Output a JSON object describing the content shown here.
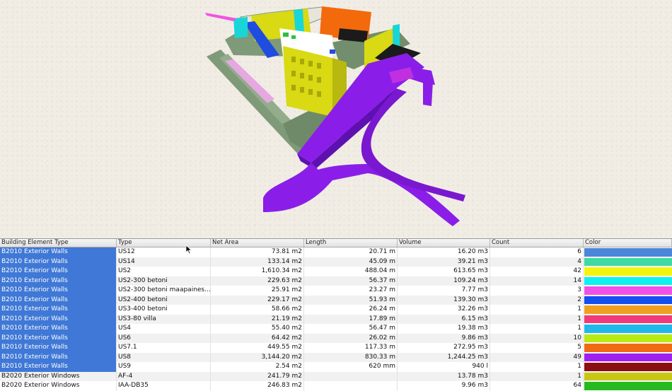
{
  "scene": {
    "colors": {
      "purple": "#8a1ee8",
      "yellow": "#d9d914",
      "sage": "#7f9a78",
      "orange": "#f26a0c",
      "cyan": "#18d6d8",
      "blue": "#1f4de0",
      "magenta": "#f055e0",
      "darkred": "#6a0f16",
      "black": "#1b1b1b",
      "green": "#2fbf3c"
    }
  },
  "table": {
    "columns": [
      "Building Element Type",
      "Type",
      "Net Area",
      "Length",
      "Volume",
      "Count",
      "Color"
    ],
    "rows": [
      {
        "bet": "B2010 Exterior Walls",
        "type": "US12",
        "area": "73.81 m2",
        "length": "20.71 m",
        "volume": "16.20 m3",
        "count": "6",
        "color": "#4a86d9",
        "selected": true
      },
      {
        "bet": "B2010 Exterior Walls",
        "type": "US14",
        "area": "133.14 m2",
        "length": "45.09 m",
        "volume": "39.21 m3",
        "count": "4",
        "color": "#3fd9a6",
        "selected": true
      },
      {
        "bet": "B2010 Exterior Walls",
        "type": "US2",
        "area": "1,610.34 m2",
        "length": "488.04 m",
        "volume": "613.65 m3",
        "count": "42",
        "color": "#f4f40e",
        "selected": true
      },
      {
        "bet": "B2010 Exterior Walls",
        "type": "US2-300 betoni",
        "area": "229.63 m2",
        "length": "56.37 m",
        "volume": "109.24 m3",
        "count": "14",
        "color": "#10f0f0",
        "selected": true
      },
      {
        "bet": "B2010 Exterior Walls",
        "type": "US2-300 betoni maapaines...",
        "area": "25.91 m2",
        "length": "23.27 m",
        "volume": "7.77 m3",
        "count": "3",
        "color": "#f050e8",
        "selected": true
      },
      {
        "bet": "B2010 Exterior Walls",
        "type": "US2-400 betoni",
        "area": "229.17 m2",
        "length": "51.93 m",
        "volume": "139.30 m3",
        "count": "2",
        "color": "#1450f0",
        "selected": true
      },
      {
        "bet": "B2010 Exterior Walls",
        "type": "US3-400 betoni",
        "area": "58.66 m2",
        "length": "26.24 m",
        "volume": "32.26 m3",
        "count": "1",
        "color": "#f0a020",
        "selected": true
      },
      {
        "bet": "B2010 Exterior Walls",
        "type": "US3-80 villa",
        "area": "21.19 m2",
        "length": "17.89 m",
        "volume": "6.15 m3",
        "count": "1",
        "color": "#f03a7a",
        "selected": true
      },
      {
        "bet": "B2010 Exterior Walls",
        "type": "US4",
        "area": "55.40 m2",
        "length": "56.47 m",
        "volume": "19.38 m3",
        "count": "1",
        "color": "#20b8e8",
        "selected": true
      },
      {
        "bet": "B2010 Exterior Walls",
        "type": "US6",
        "area": "64.42 m2",
        "length": "26.02 m",
        "volume": "9.86 m3",
        "count": "10",
        "color": "#b8ea14",
        "selected": true
      },
      {
        "bet": "B2010 Exterior Walls",
        "type": "US7.1",
        "area": "449.55 m2",
        "length": "117.33 m",
        "volume": "272.95 m3",
        "count": "5",
        "color": "#f06a12",
        "selected": true
      },
      {
        "bet": "B2010 Exterior Walls",
        "type": "US8",
        "area": "3,144.20 m2",
        "length": "830.33 m",
        "volume": "1,244.25 m3",
        "count": "49",
        "color": "#a020f0",
        "selected": true
      },
      {
        "bet": "B2010 Exterior Walls",
        "type": "US9",
        "area": "2.54 m2",
        "length": "620 mm",
        "volume": "940 l",
        "count": "1",
        "color": "#8a0f12",
        "selected": true
      },
      {
        "bet": "B2020 Exterior Windows",
        "type": "AF-4",
        "area": "241.79 m2",
        "length": "",
        "volume": "13.78 m3",
        "count": "1",
        "color": "#c8c814",
        "selected": false
      },
      {
        "bet": "B2020 Exterior Windows",
        "type": "IAA-DB35",
        "area": "246.83 m2",
        "length": "",
        "volume": "9.96 m3",
        "count": "64",
        "color": "#28b820",
        "selected": false
      }
    ]
  }
}
